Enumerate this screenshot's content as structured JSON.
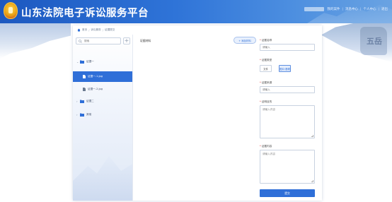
{
  "header": {
    "site_title": "山东法院电子诉讼服务平台",
    "nav": [
      "我的案件",
      "消息中心",
      "个人中心",
      "退出"
    ]
  },
  "breadcrumb": [
    "首页",
    "诉讼服务",
    "证据提交"
  ],
  "tree": {
    "search_placeholder": "搜索",
    "add_label": "+",
    "items": [
      {
        "label": "证据一",
        "type": "folder",
        "expanded": true
      },
      {
        "label": "证据一-1.jpg",
        "type": "file",
        "active": true
      },
      {
        "label": "证据一-2.jpg",
        "type": "file",
        "active": false
      },
      {
        "label": "证据二",
        "type": "folder",
        "expanded": false
      },
      {
        "label": "其他",
        "type": "folder",
        "expanded": false
      }
    ]
  },
  "middle": {
    "title": "证据材料",
    "upload_label": "+ 添加材料"
  },
  "form": {
    "name_label": "证据名称",
    "name_placeholder": "请输入",
    "type_label": "证据类型",
    "type_options": [
      "文件",
      "图片/音频"
    ],
    "source_label": "证据来源",
    "source_placeholder": "请输入",
    "purpose_label": "证明目的",
    "purpose_placeholder": "请输入内容",
    "content_label": "证据内容",
    "content_placeholder": "请输入内容",
    "save_label": "提交"
  },
  "colors": {
    "primary": "#2f6fd8",
    "header_start": "#1c58c0",
    "required": "#e23b3b"
  }
}
